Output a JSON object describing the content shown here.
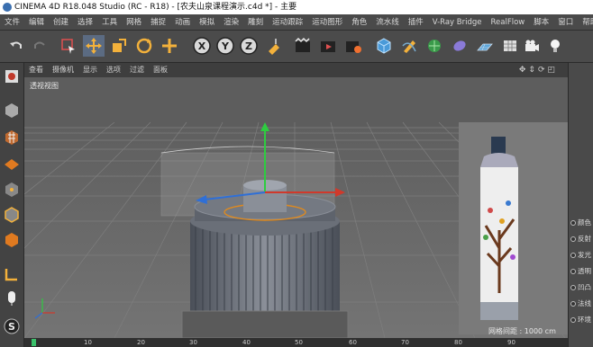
{
  "window": {
    "title": "CINEMA 4D R18.048 Studio (RC - R18) - [农夫山泉课程演示.c4d *] - 主要"
  },
  "menu": [
    "文件",
    "编辑",
    "创建",
    "选择",
    "工具",
    "网格",
    "捕捉",
    "动画",
    "模拟",
    "渲染",
    "雕刻",
    "运动跟踪",
    "运动图形",
    "角色",
    "流水线",
    "插件",
    "V-Ray Bridge",
    "RealFlow",
    "脚本",
    "窗口",
    "帮助"
  ],
  "viewport_menu": [
    "查看",
    "摄像机",
    "显示",
    "选项",
    "过滤",
    "面板"
  ],
  "viewport": {
    "label": "透视视图",
    "grid_distance": "网格间距 : 1000 cm"
  },
  "toolbar": {
    "axis_x": "X",
    "axis_y": "Y",
    "axis_z": "Z"
  },
  "right_panel": [
    "颜色",
    "反射",
    "发光",
    "透明",
    "凹凸",
    "法线",
    "环境"
  ],
  "timeline": {
    "ticks": [
      "0",
      "10",
      "20",
      "30",
      "40",
      "50",
      "60",
      "70",
      "80",
      "90"
    ]
  },
  "colors": {
    "accent_selected": "#5b6b82",
    "viewport_bg": "#6a6a6a",
    "axis_x": "#c0392b",
    "axis_y": "#2ecc40",
    "axis_z": "#2f6fd6"
  }
}
